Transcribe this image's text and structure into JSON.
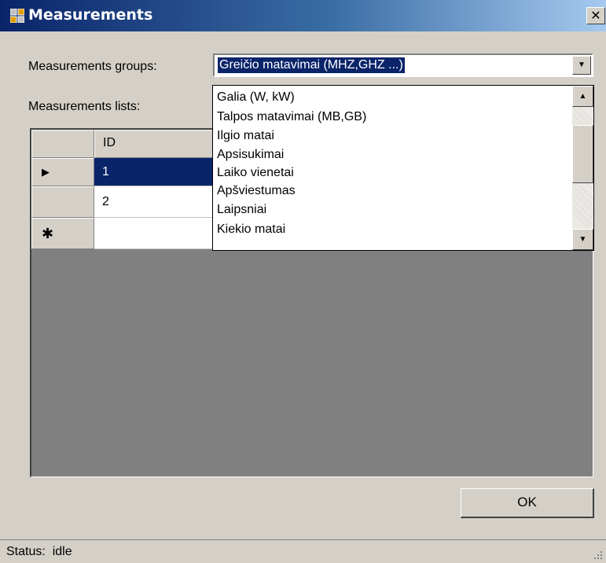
{
  "window": {
    "title": "Measurements"
  },
  "groups": {
    "label": "Measurements groups:",
    "selected": "Greičio matavimai (MHZ,GHZ ...)",
    "options": [
      "Galia (W, kW)",
      "Talpos matavimai (MB,GB)",
      "Ilgio matai",
      "Apsisukimai",
      "Laiko vienetai",
      "Apšviestumas",
      "Laipsniai",
      "Kiekio matai"
    ]
  },
  "lists": {
    "label": "Measurements lists:",
    "columns": [
      "ID"
    ],
    "rows": [
      {
        "indicator": "▶",
        "id": "1"
      },
      {
        "indicator": "",
        "id": "2"
      },
      {
        "indicator": "✱",
        "id": ""
      }
    ]
  },
  "buttons": {
    "ok": "OK"
  },
  "status": {
    "label": "Status:",
    "value": "idle"
  },
  "colors": {
    "selection": "#0a246a",
    "face": "#d4d0c8",
    "grid_bg": "#808080"
  },
  "icons": {
    "app": "grid-app-icon",
    "close": "close-icon",
    "dropdown": "chevron-down-icon"
  }
}
